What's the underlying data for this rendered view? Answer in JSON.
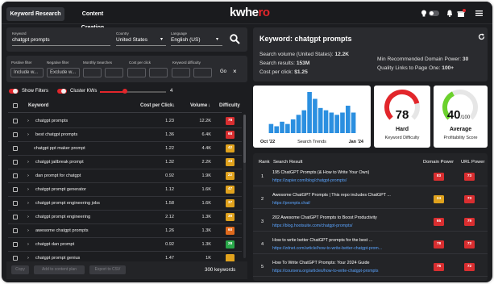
{
  "app": {
    "tabs": [
      {
        "label": "Keyword Research",
        "active": true
      },
      {
        "label": "Content Creation",
        "active": false
      }
    ],
    "logo_main": "kwhe",
    "logo_accent": "ro"
  },
  "search": {
    "keyword_label": "Keyword",
    "keyword_value": "chatgpt prompts",
    "country_label": "Country",
    "country_value": "United States",
    "language_label": "Language",
    "language_value": "English (US)"
  },
  "filters": {
    "positive_label": "Positive filter",
    "positive_placeholder": "Include w...",
    "negative_label": "Negative filter",
    "negative_placeholder": "Exclude w...",
    "monthly_label": "Monthly Searches",
    "cpc_label": "Cost per click",
    "kd_label": "Keyword difficulty",
    "go_label": "Go",
    "show_filters": "Show Filters",
    "cluster_kws": "Cluster KWs",
    "slider_value": "4"
  },
  "table": {
    "headers": {
      "keyword": "Keyword",
      "cpc": "Cost per Click",
      "volume": "Volume",
      "difficulty": "Difficulty"
    },
    "rows": [
      {
        "keyword": "chatgpt prompts",
        "expandable": true,
        "cpc": "1.23",
        "volume": "12.2K",
        "kd": "78",
        "color": "#d92e30"
      },
      {
        "keyword": "best chatgpt prompts",
        "expandable": true,
        "cpc": "1.36",
        "volume": "6.4K",
        "kd": "68",
        "color": "#d92e30"
      },
      {
        "keyword": "chatgpt ppt maker prompt",
        "expandable": false,
        "cpc": "1.22",
        "volume": "4.4K",
        "kd": "42",
        "color": "#e0a21d"
      },
      {
        "keyword": "chatgpt jailbreak prompt",
        "expandable": true,
        "cpc": "1.32",
        "volume": "2.2K",
        "kd": "43",
        "color": "#e0a21d"
      },
      {
        "keyword": "dan prompt for chatgpt",
        "expandable": true,
        "cpc": "0.92",
        "volume": "1.9K",
        "kd": "22",
        "color": "#e0a21d"
      },
      {
        "keyword": "chatgpt prompt generator",
        "expandable": true,
        "cpc": "1.12",
        "volume": "1.6K",
        "kd": "47",
        "color": "#e0a21d"
      },
      {
        "keyword": "chatgpt prompt engineering jobs",
        "expandable": true,
        "cpc": "1.58",
        "volume": "1.6K",
        "kd": "37",
        "color": "#e0a21d"
      },
      {
        "keyword": "chatgpt prompt engineering",
        "expandable": true,
        "cpc": "2.12",
        "volume": "1.3K",
        "kd": "39",
        "color": "#e0a21d"
      },
      {
        "keyword": "awesome chatgpt prompts",
        "expandable": true,
        "cpc": "1.26",
        "volume": "1.3K",
        "kd": "60",
        "color": "#e06a1d"
      },
      {
        "keyword": "chatgpt dan prompt",
        "expandable": true,
        "cpc": "0.92",
        "volume": "1.3K",
        "kd": "28",
        "color": "#2aa84a"
      },
      {
        "keyword": "chatgpt prompt genius",
        "expandable": true,
        "cpc": "1.47",
        "volume": "1K",
        "kd": "",
        "color": "#e0a21d"
      }
    ],
    "footer": {
      "copy": "Copy",
      "add": "Add to content plan",
      "export": "Export to CSV",
      "count": "300 keywords"
    }
  },
  "overview": {
    "title": "Keyword: chatgpt prompts",
    "volume": "Search volume (United States):",
    "volume_value": "12.2K",
    "results": "Search results:",
    "results_value": "153M",
    "cpc": "Cost per click:",
    "cpc_value": "$1.25",
    "min_dp": "Min Recommended Domain Power:",
    "min_dp_value": "30",
    "quality": "Quality Links to Page One:",
    "quality_value": "100+"
  },
  "chart_data": {
    "type": "bar",
    "title": "Search Trends",
    "x_start_label": "Oct '22",
    "x_end_label": "Jan '24",
    "values": [
      4,
      3,
      5,
      4,
      6,
      8,
      10,
      18,
      15,
      11,
      10,
      9,
      8,
      9,
      12,
      9
    ]
  },
  "gauges": {
    "kd": {
      "value": "78",
      "percent": 78,
      "word": "Hard",
      "label": "Keyword Difficulty",
      "color": "#e2262b"
    },
    "profit": {
      "value": "40",
      "suffix": "/100",
      "percent": 40,
      "word": "Average",
      "label": "Profitability Score",
      "color": "#6bd12c"
    }
  },
  "results": {
    "headers": {
      "rank": "Rank",
      "result": "Search Result",
      "dp": "Domain Power",
      "up": "URL Power"
    },
    "rows": [
      {
        "rank": "1",
        "title": "195 ChatGPT Prompts (& How to Write Your Own)",
        "url": "https://zapier.com/blog/chatgpt-prompts/",
        "dp": "83",
        "dp_color": "#d92e30",
        "up": "73",
        "up_color": "#d92e30"
      },
      {
        "rank": "2",
        "title": "Awesome ChatGPT Prompts | This repo includes ChatGPT ...",
        "url": "https://prompts.chat/",
        "dp": "24",
        "dp_color": "#e0a21d",
        "up": "73",
        "up_color": "#d92e30"
      },
      {
        "rank": "3",
        "title": "202 Awesome ChatGPT Prompts to Boost Productivity",
        "url": "https://blog.hootsuite.com/chatgpt-prompts/",
        "dp": "65",
        "dp_color": "#d92e30",
        "up": "79",
        "up_color": "#d92e30"
      },
      {
        "rank": "4",
        "title": "How to write better ChatGPT prompts for the best ...",
        "url": "https://zdnet.com/article/how-to-write-better-chatgpt-prom...",
        "dp": "78",
        "dp_color": "#d92e30",
        "up": "72",
        "up_color": "#d92e30"
      },
      {
        "rank": "5",
        "title": "How To Write ChatGPT Prompts: Your 2024 Guide",
        "url": "https://coursera.org/articles/how-to-write-chatgpt-prompts",
        "dp": "76",
        "dp_color": "#d92e30",
        "up": "72",
        "up_color": "#d92e30"
      }
    ]
  }
}
